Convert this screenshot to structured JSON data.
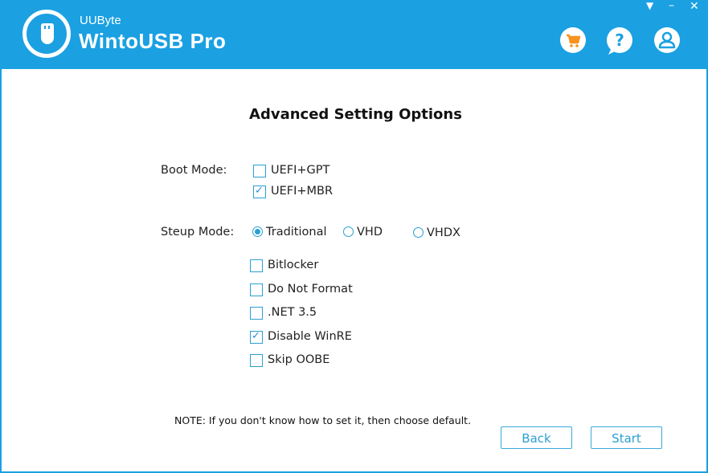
{
  "header": {
    "brand_small": "UUByte",
    "brand_title": "WintoUSB Pro",
    "logo_icon": "usb-drive-icon",
    "window_controls": {
      "menu": "▼",
      "minimize": "–",
      "close": "✕"
    },
    "icons": [
      "cart-icon",
      "help-icon",
      "account-icon"
    ]
  },
  "colors": {
    "accent": "#1ba0e2",
    "cart": "#f7931e",
    "checkbox": "#2b9fd3"
  },
  "main": {
    "title": "Advanced Setting Options",
    "boot_mode": {
      "label": "Boot Mode:",
      "options": [
        {
          "label": "UEFI+GPT",
          "checked": false
        },
        {
          "label": "UEFI+MBR",
          "checked": true
        }
      ]
    },
    "setup_mode": {
      "label": "Steup Mode:",
      "options": [
        {
          "label": "Traditional",
          "selected": true
        },
        {
          "label": "VHD",
          "selected": false
        },
        {
          "label": "VHDX",
          "selected": false
        }
      ]
    },
    "extras": [
      {
        "label": "Bitlocker",
        "checked": false
      },
      {
        "label": "Do Not Format",
        "checked": false
      },
      {
        "label": ".NET 3.5",
        "checked": false
      },
      {
        "label": "Disable WinRE",
        "checked": true
      },
      {
        "label": "Skip OOBE",
        "checked": false
      }
    ],
    "note": "NOTE: If you don't know how to set it, then choose default."
  },
  "footer": {
    "back_label": "Back",
    "start_label": "Start"
  }
}
